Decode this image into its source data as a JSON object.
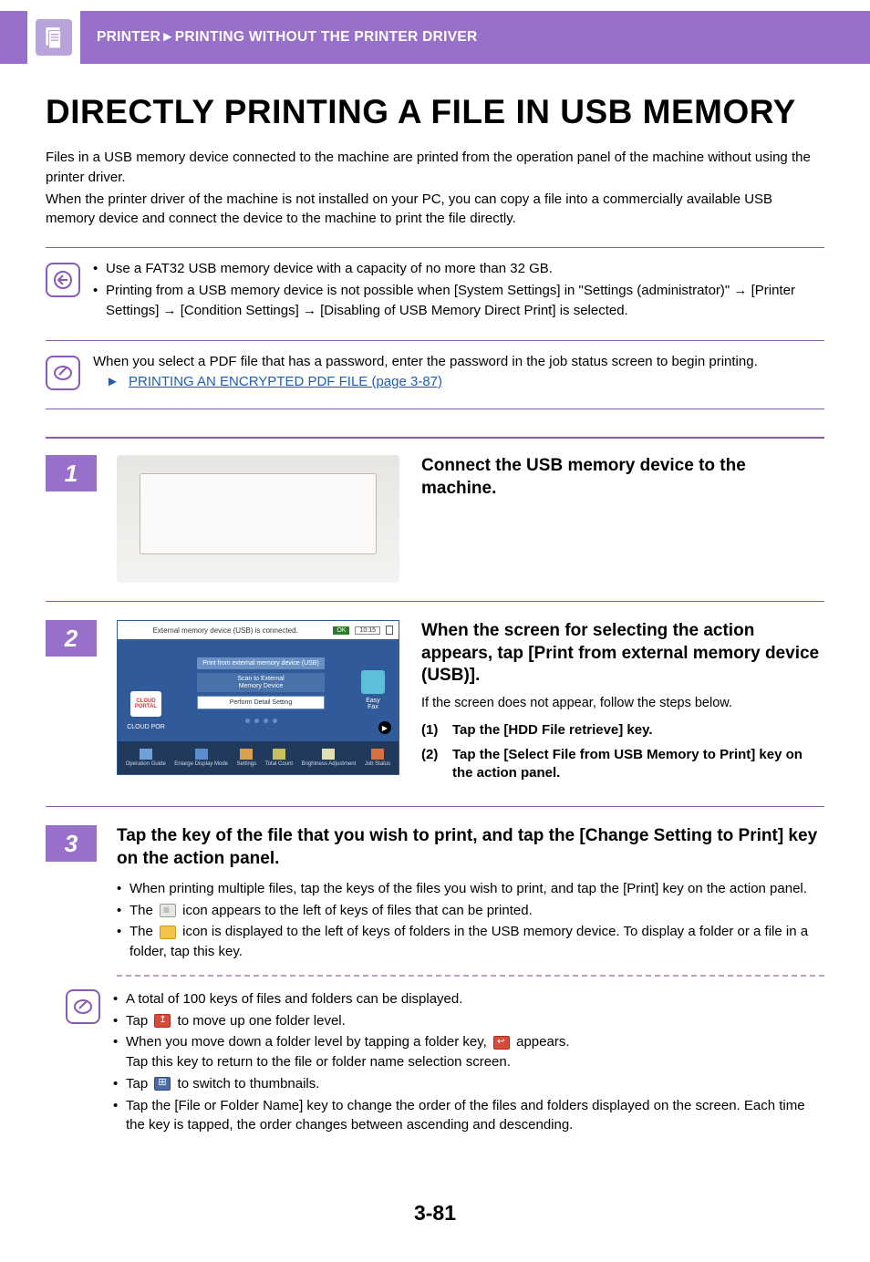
{
  "header": {
    "breadcrumb_section": "PRINTER",
    "breadcrumb_sep": "►",
    "breadcrumb_page": "PRINTING WITHOUT THE PRINTER DRIVER"
  },
  "title": "DIRECTLY PRINTING A FILE IN USB MEMORY",
  "intro": {
    "p1": "Files in a USB memory device connected to the machine are printed from the operation panel of the machine without using the printer driver.",
    "p2": "When the printer driver of the machine is not installed on your PC, you can copy a file into a commercially available USB memory device and connect the device to the machine to print the file directly."
  },
  "callout_restrict": {
    "b1": "Use a FAT32 USB memory device with a capacity of no more than 32 GB.",
    "b2": "Printing from a USB memory device is not possible when [System Settings] in \"Settings (administrator)\" → [Printer Settings] → [Condition Settings] → [Disabling of USB Memory Direct Print] is selected."
  },
  "callout_note": {
    "line": "When you select a PDF file that has a password, enter the password in the job status screen to begin printing.",
    "link_label": "PRINTING AN ENCRYPTED PDF FILE (page 3-87)"
  },
  "steps": {
    "s1": {
      "num": "1",
      "heading": "Connect the USB memory device to the machine."
    },
    "s2": {
      "num": "2",
      "heading": "When the screen for selecting the action appears, tap [Print from external memory device (USB)].",
      "sub": "If the screen does not appear, follow the steps below.",
      "items": {
        "i1n": "(1)",
        "i1t": "Tap the [HDD File retrieve] key.",
        "i2n": "(2)",
        "i2t": "Tap the [Select File from USB Memory to Print] key on the action panel."
      },
      "panel": {
        "msg": "External memory device (USB) is connected.",
        "ok": "OK",
        "time": "10:15",
        "cloud1": "CLOUD",
        "cloud2": "PORTAL",
        "cloud_lbl": "CLOUD POR",
        "btn1": "Print from external memory device (USB)",
        "btn2a": "Scan to External",
        "btn2b": "Memory Device",
        "btn3": "Perform Detail Setting",
        "easy1": "Easy",
        "easy2": "Fax",
        "bot": {
          "b1": "Operation Guide",
          "b2": "Enlarge Display Mode",
          "b3": "Settings",
          "b4": "Total Count",
          "b5": "Brightness Adjustment",
          "b6": "Job Status"
        }
      }
    },
    "s3": {
      "num": "3",
      "heading": "Tap the key of the file that you wish to print, and tap the [Change Setting to Print] key on the action panel.",
      "b1": "When printing multiple files, tap the keys of the files you wish to print, and tap the [Print] key on the action panel.",
      "b2a": "The ",
      "b2b": " icon appears to the left of keys of files that can be printed.",
      "b3a": "The ",
      "b3b": " icon is displayed to the left of keys of folders in the USB memory device. To display a folder or a file in a folder, tap this key.",
      "note": {
        "n1": "A total of 100 keys of files and folders can be displayed.",
        "n2a": "Tap ",
        "n2b": " to move up one folder level.",
        "n3a": "When you move down a folder level by tapping a folder key, ",
        "n3b": " appears.",
        "n3c": "Tap this key to return to the file or folder name selection screen.",
        "n4a": "Tap ",
        "n4b": " to switch to thumbnails.",
        "n5": "Tap the [File or Folder Name] key to change the order of the files and folders displayed on the screen. Each time the key is tapped, the order changes between ascending and descending."
      }
    }
  },
  "page_number": "3-81"
}
